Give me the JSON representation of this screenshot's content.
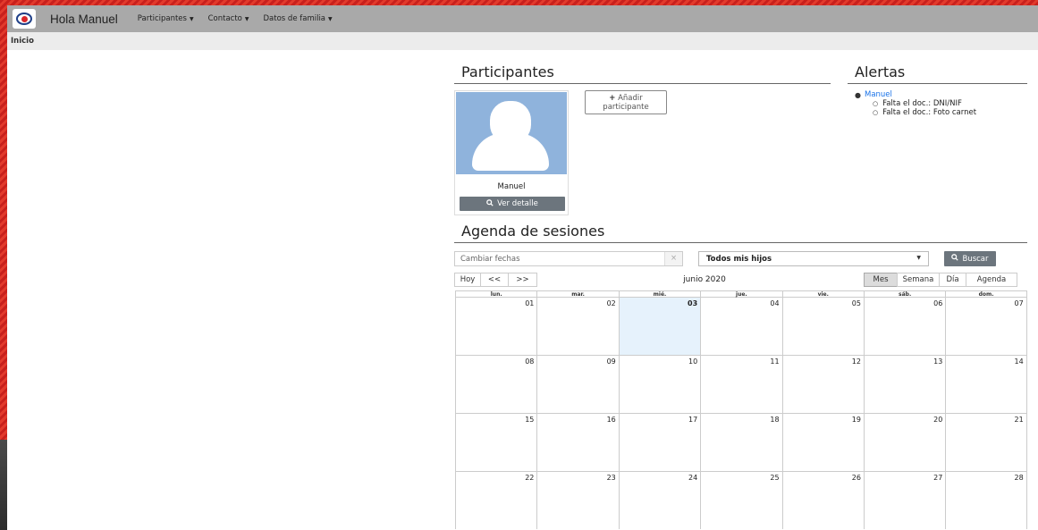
{
  "navbar": {
    "brand": "Hola Manuel",
    "menu": [
      {
        "label": "Participantes"
      },
      {
        "label": "Contacto"
      },
      {
        "label": "Datos de familia"
      }
    ]
  },
  "breadcrumb": "Inicio",
  "participants": {
    "title": "Participantes",
    "card": {
      "name": "Manuel",
      "detail_label": "Ver detalle"
    },
    "add_line1": "Añadir",
    "add_line2": "participante"
  },
  "alerts": {
    "title": "Alertas",
    "person": "Manuel",
    "items": [
      "Falta el doc.: DNI/NIF",
      "Falta el doc.: Foto carnet"
    ]
  },
  "agenda": {
    "title": "Agenda de sesiones",
    "date_placeholder": "Cambiar fechas",
    "clear_symbol": "×",
    "select_value": "Todos mis hijos",
    "search_label": "Buscar",
    "nav": {
      "today": "Hoy",
      "prev": "<<",
      "next": ">>"
    },
    "current": "junio 2020",
    "views": {
      "month": "Mes",
      "week": "Semana",
      "day": "Día",
      "agenda": "Agenda"
    },
    "active_view": "Mes",
    "weekdays": [
      "lun.",
      "mar.",
      "mié.",
      "jue.",
      "vie.",
      "sáb.",
      "dom."
    ],
    "weeks": [
      [
        "01",
        "02",
        "03",
        "04",
        "05",
        "06",
        "07"
      ],
      [
        "08",
        "09",
        "10",
        "11",
        "12",
        "13",
        "14"
      ],
      [
        "15",
        "16",
        "17",
        "18",
        "19",
        "20",
        "21"
      ],
      [
        "22",
        "23",
        "24",
        "25",
        "26",
        "27",
        "28"
      ]
    ],
    "today_day": "03"
  },
  "colors": {
    "navbar_bg": "#a9a9a9",
    "button_gray": "#6c757d",
    "link_blue": "#1a73e8",
    "today_bg": "#e6f2fc",
    "avatar_bg": "#8fb3dc"
  },
  "icons": [
    "logo-icon",
    "search-icon",
    "plus-icon",
    "caret-down-icon"
  ]
}
